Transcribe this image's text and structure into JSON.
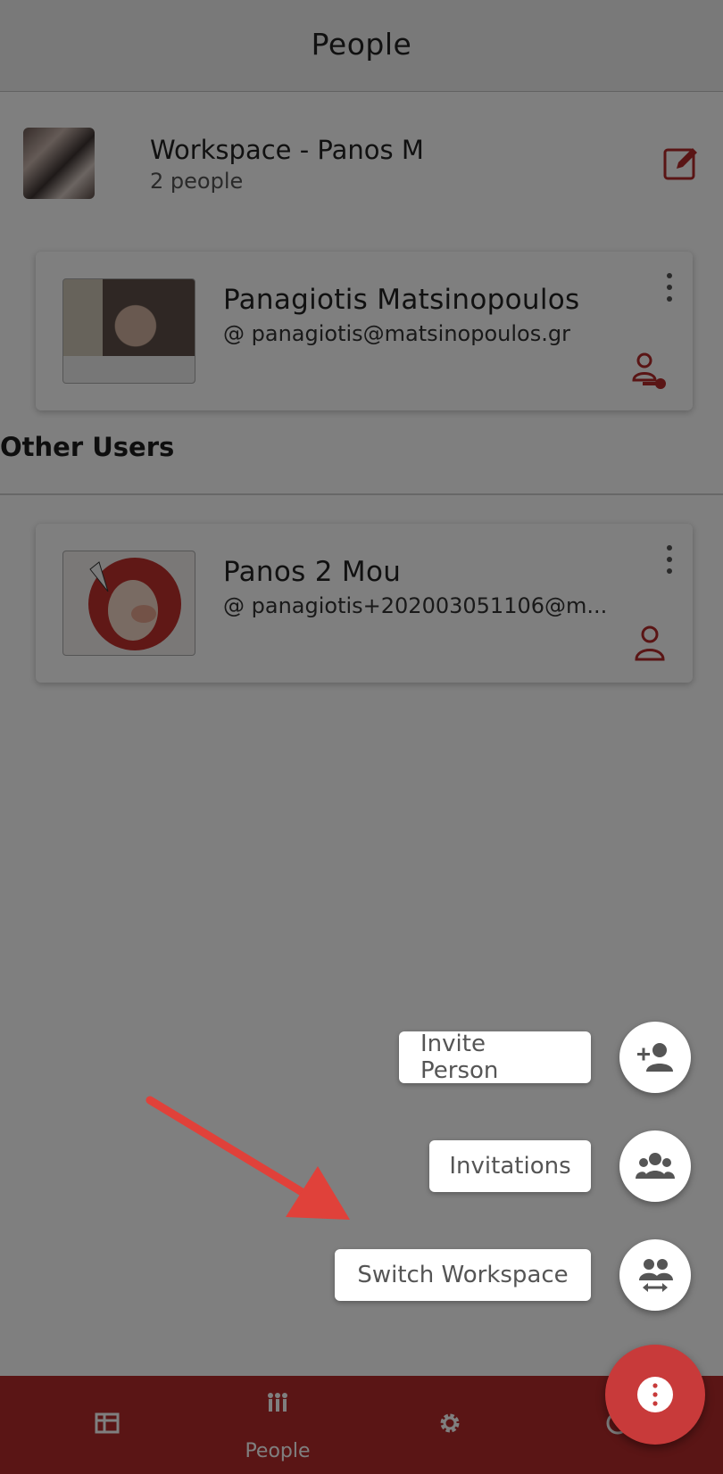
{
  "header": {
    "title": "People"
  },
  "workspace": {
    "title": "Workspace - Panos M",
    "count": "2 people"
  },
  "owner": {
    "name": "Panagiotis Matsinopoulos",
    "email": "@ panagiotis@matsinopoulos.gr"
  },
  "other_users": {
    "section_label": "Other Users",
    "items": [
      {
        "name": "Panos 2 Mou",
        "email": "@ panagiotis+202003051106@m..."
      }
    ]
  },
  "speed_dial": {
    "items": [
      {
        "label": "Invite Person",
        "icon": "person-add-icon"
      },
      {
        "label": "Invitations",
        "icon": "group-icon"
      },
      {
        "label": "Switch Workspace",
        "icon": "switch-group-icon"
      }
    ],
    "main_icon": "more-vert-icon"
  },
  "bottom_nav": {
    "items": [
      {
        "label": "",
        "icon": "table-icon"
      },
      {
        "label": "People",
        "icon": "people-icon"
      },
      {
        "label": "",
        "icon": "gear-icon"
      },
      {
        "label": "",
        "icon": "help-icon"
      }
    ]
  },
  "colors": {
    "brand": "#b52a2a",
    "fab": "#c83a3a",
    "annotation_arrow": "#e0413a"
  }
}
